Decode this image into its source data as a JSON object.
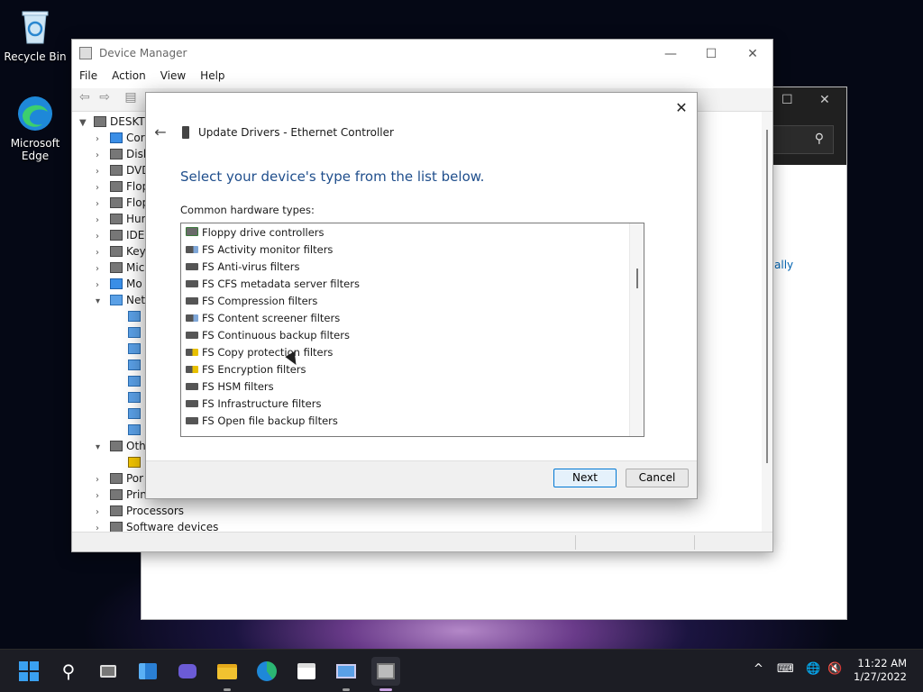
{
  "desktop": {
    "icons": [
      {
        "label": "Recycle Bin",
        "icon": "recycle-bin-icon"
      },
      {
        "label": "Microsoft Edge",
        "icon": "edge-icon"
      }
    ]
  },
  "background_window": {
    "link_text": "ally",
    "search_icon": "search-icon"
  },
  "device_manager": {
    "title": "Device Manager",
    "controls": {
      "minimize": "—",
      "maximize": "☐",
      "close": "✕"
    },
    "menu": [
      "File",
      "Action",
      "View",
      "Help"
    ],
    "tree": {
      "root": "DESKTO",
      "nodes": [
        {
          "label": "Cor",
          "icon": "monitor-icon"
        },
        {
          "label": "Disk",
          "icon": "disk-icon"
        },
        {
          "label": "DVD",
          "icon": "dvd-icon"
        },
        {
          "label": "Flop",
          "icon": "floppy-icon"
        },
        {
          "label": "Flop",
          "icon": "floppy-controller-icon"
        },
        {
          "label": "Hur",
          "icon": "hid-icon"
        },
        {
          "label": "IDE",
          "icon": "ide-icon"
        },
        {
          "label": "Key",
          "icon": "keyboard-icon"
        },
        {
          "label": "Mic",
          "icon": "mouse-icon"
        },
        {
          "label": "Mo",
          "icon": "monitor-icon"
        },
        {
          "label": "Net",
          "icon": "network-icon"
        },
        {
          "label": "Oth",
          "icon": "other-devices-icon"
        },
        {
          "label": "Por",
          "icon": "port-icon"
        },
        {
          "label": "Prin",
          "icon": "printer-icon"
        },
        {
          "label": "Processors",
          "icon": "processor-icon"
        },
        {
          "label": "Software devices",
          "icon": "software-icon"
        }
      ]
    }
  },
  "dialog": {
    "title": "Update Drivers - Ethernet Controller",
    "heading": "Select your device's type from the list below.",
    "list_label": "Common hardware types:",
    "items": [
      {
        "label": "Floppy drive controllers",
        "icon": "floppy-controller-icon"
      },
      {
        "label": "FS Activity monitor filters",
        "icon": "filter-search-icon"
      },
      {
        "label": "FS Anti-virus filters",
        "icon": "filter-icon"
      },
      {
        "label": "FS CFS metadata server filters",
        "icon": "filter-icon"
      },
      {
        "label": "FS Compression filters",
        "icon": "filter-icon"
      },
      {
        "label": "FS Content screener filters",
        "icon": "filter-search-icon"
      },
      {
        "label": "FS Continuous backup filters",
        "icon": "filter-icon"
      },
      {
        "label": "FS Copy protection filters",
        "icon": "filter-lock-icon"
      },
      {
        "label": "FS Encryption filters",
        "icon": "filter-lock-icon"
      },
      {
        "label": "FS HSM filters",
        "icon": "filter-icon"
      },
      {
        "label": "FS Infrastructure filters",
        "icon": "filter-icon"
      },
      {
        "label": "FS Open file backup filters",
        "icon": "filter-icon"
      }
    ],
    "buttons": {
      "next": "Next",
      "cancel": "Cancel"
    }
  },
  "taskbar": {
    "apps": [
      "start-icon",
      "search-icon",
      "task-view-icon",
      "widgets-icon",
      "chat-icon",
      "file-explorer-icon",
      "edge-icon",
      "store-icon",
      "control-panel-icon",
      "device-manager-icon"
    ],
    "tray": {
      "chevron": "^",
      "keyboard": "⌨",
      "network": "🌐",
      "sound": "🔇"
    },
    "time": "11:22 AM",
    "date": "1/27/2022"
  },
  "colors": {
    "heading": "#1f4e8c",
    "accent": "#0078d4",
    "taskbar": "#1c1d24"
  }
}
